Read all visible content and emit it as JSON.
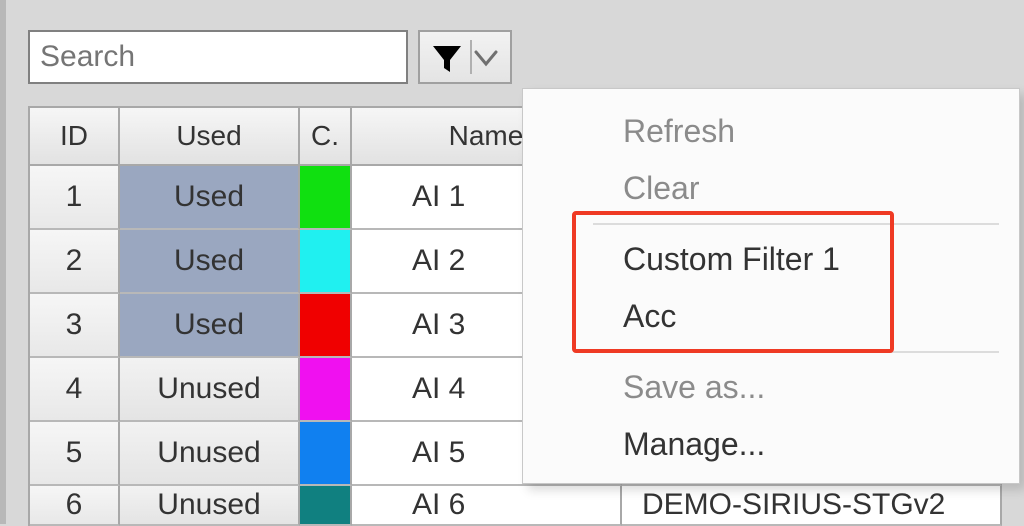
{
  "search": {
    "placeholder": "Search"
  },
  "columns": {
    "id": "ID",
    "used": "Used",
    "color": "C.",
    "name": "Name"
  },
  "rows": [
    {
      "id": "1",
      "used": "Used",
      "used_state": "on",
      "color": "#10e010",
      "name": "AI 1"
    },
    {
      "id": "2",
      "used": "Used",
      "used_state": "on",
      "color": "#20f0f0",
      "name": "AI 2"
    },
    {
      "id": "3",
      "used": "Used",
      "used_state": "on",
      "color": "#f00000",
      "name": "AI 3"
    },
    {
      "id": "4",
      "used": "Unused",
      "used_state": "off",
      "color": "#f010f0",
      "name": "AI 4"
    },
    {
      "id": "5",
      "used": "Unused",
      "used_state": "off",
      "color": "#1080f0",
      "name": "AI 5"
    },
    {
      "id": "6",
      "used": "Unused",
      "used_state": "off",
      "color": "#108080",
      "name": "AI 6"
    }
  ],
  "rest_text": "DEMO-SIRIUS-STGv2",
  "menu": {
    "refresh": "Refresh",
    "clear": "Clear",
    "custom1": "Custom Filter 1",
    "acc": "Acc",
    "saveas": "Save as...",
    "manage": "Manage..."
  }
}
